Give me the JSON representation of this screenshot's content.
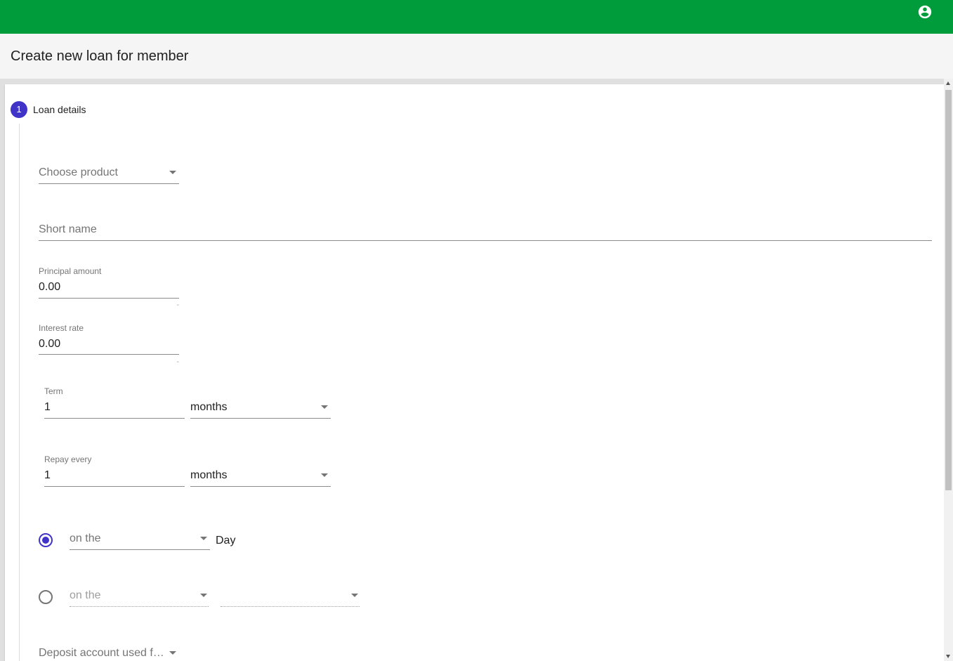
{
  "header": {
    "account_icon": "account-circle-icon",
    "color": "#009c3b"
  },
  "page": {
    "title": "Create new loan for member"
  },
  "stepper": {
    "step_number": "1",
    "step_label": "Loan details",
    "accent": "#3f33c8"
  },
  "form": {
    "product": {
      "placeholder": "Choose product"
    },
    "short_name": {
      "placeholder": "Short name"
    },
    "principal": {
      "label": "Principal amount",
      "value": "0.00",
      "hint": "-"
    },
    "interest": {
      "label": "Interest rate",
      "value": "0.00",
      "hint": "-"
    },
    "term": {
      "label": "Term",
      "value": "1",
      "unit": "months"
    },
    "repay": {
      "label": "Repay every",
      "value": "1",
      "unit": "months"
    },
    "repay_option_1": {
      "selected": true,
      "placeholder": "on the",
      "suffix": "Day"
    },
    "repay_option_2": {
      "selected": false,
      "placeholder": "on the",
      "second_value": ""
    },
    "deposit_account": {
      "placeholder": "Deposit account used for…"
    }
  }
}
